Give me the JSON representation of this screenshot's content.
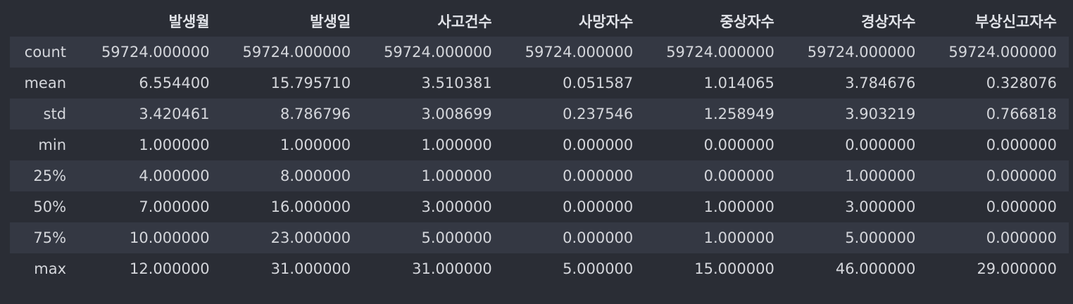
{
  "table": {
    "columns": [
      "발생월",
      "발생일",
      "사고건수",
      "사망자수",
      "중상자수",
      "경상자수",
      "부상신고자수"
    ],
    "rows": [
      {
        "index": "count",
        "values": [
          "59724.000000",
          "59724.000000",
          "59724.000000",
          "59724.000000",
          "59724.000000",
          "59724.000000",
          "59724.000000"
        ]
      },
      {
        "index": "mean",
        "values": [
          "6.554400",
          "15.795710",
          "3.510381",
          "0.051587",
          "1.014065",
          "3.784676",
          "0.328076"
        ]
      },
      {
        "index": "std",
        "values": [
          "3.420461",
          "8.786796",
          "3.008699",
          "0.237546",
          "1.258949",
          "3.903219",
          "0.766818"
        ]
      },
      {
        "index": "min",
        "values": [
          "1.000000",
          "1.000000",
          "1.000000",
          "0.000000",
          "0.000000",
          "0.000000",
          "0.000000"
        ]
      },
      {
        "index": "25%",
        "values": [
          "4.000000",
          "8.000000",
          "1.000000",
          "0.000000",
          "0.000000",
          "1.000000",
          "0.000000"
        ]
      },
      {
        "index": "50%",
        "values": [
          "7.000000",
          "16.000000",
          "3.000000",
          "0.000000",
          "1.000000",
          "3.000000",
          "0.000000"
        ]
      },
      {
        "index": "75%",
        "values": [
          "10.000000",
          "23.000000",
          "5.000000",
          "0.000000",
          "1.000000",
          "5.000000",
          "0.000000"
        ]
      },
      {
        "index": "max",
        "values": [
          "12.000000",
          "31.000000",
          "31.000000",
          "5.000000",
          "15.000000",
          "46.000000",
          "29.000000"
        ]
      }
    ]
  }
}
